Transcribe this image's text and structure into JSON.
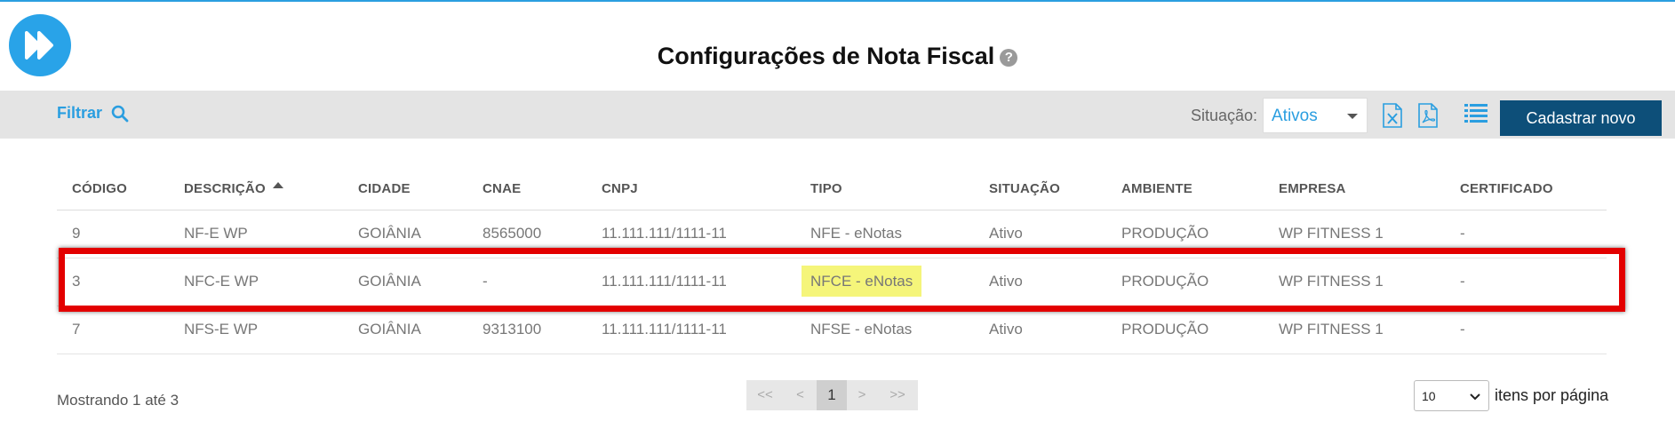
{
  "header": {
    "title": "Configurações de Nota Fiscal",
    "help_icon": "?",
    "logo_icon": "fast-forward-icon"
  },
  "toolbar": {
    "filter_label": "Filtrar",
    "status_label": "Situação:",
    "status_value": "Ativos",
    "new_button_label": "Cadastrar novo",
    "icons": [
      "excel-export-icon",
      "pdf-export-icon",
      "list-view-icon"
    ]
  },
  "table": {
    "columns": [
      "CÓDIGO",
      "DESCRIÇÃO",
      "CIDADE",
      "CNAE",
      "CNPJ",
      "TIPO",
      "SITUAÇÃO",
      "AMBIENTE",
      "EMPRESA",
      "CERTIFICADO"
    ],
    "sorted_column": "DESCRIÇÃO",
    "rows": [
      [
        "9",
        "NF-E WP",
        "GOIÂNIA",
        "8565000",
        "11.111.111/1111-11",
        "NFE - eNotas",
        "Ativo",
        "PRODUÇÃO",
        "WP FITNESS 1",
        "-"
      ],
      [
        "3",
        "NFC-E WP",
        "GOIÂNIA",
        "-",
        "11.111.111/1111-11",
        "NFCE - eNotas",
        "Ativo",
        "PRODUÇÃO",
        "WP FITNESS 1",
        "-"
      ],
      [
        "7",
        "NFS-E WP",
        "GOIÂNIA",
        "9313100",
        "11.111.111/1111-11",
        "NFSE - eNotas",
        "Ativo",
        "PRODUÇÃO",
        "WP FITNESS 1",
        "-"
      ]
    ],
    "highlighted_row_index": 1
  },
  "footer": {
    "showing_text": "Mostrando 1 até 3",
    "pager": [
      "<<",
      "<",
      "1",
      ">",
      ">>"
    ],
    "current_page": "1",
    "per_page_value": "10",
    "per_page_label": "itens por página"
  },
  "colors": {
    "accent": "#2a9ee0",
    "primary_button": "#0d4f79",
    "highlight": "#f5f57a",
    "annotation_box": "#e30000",
    "toolbar_bg": "#e4e4e4"
  }
}
